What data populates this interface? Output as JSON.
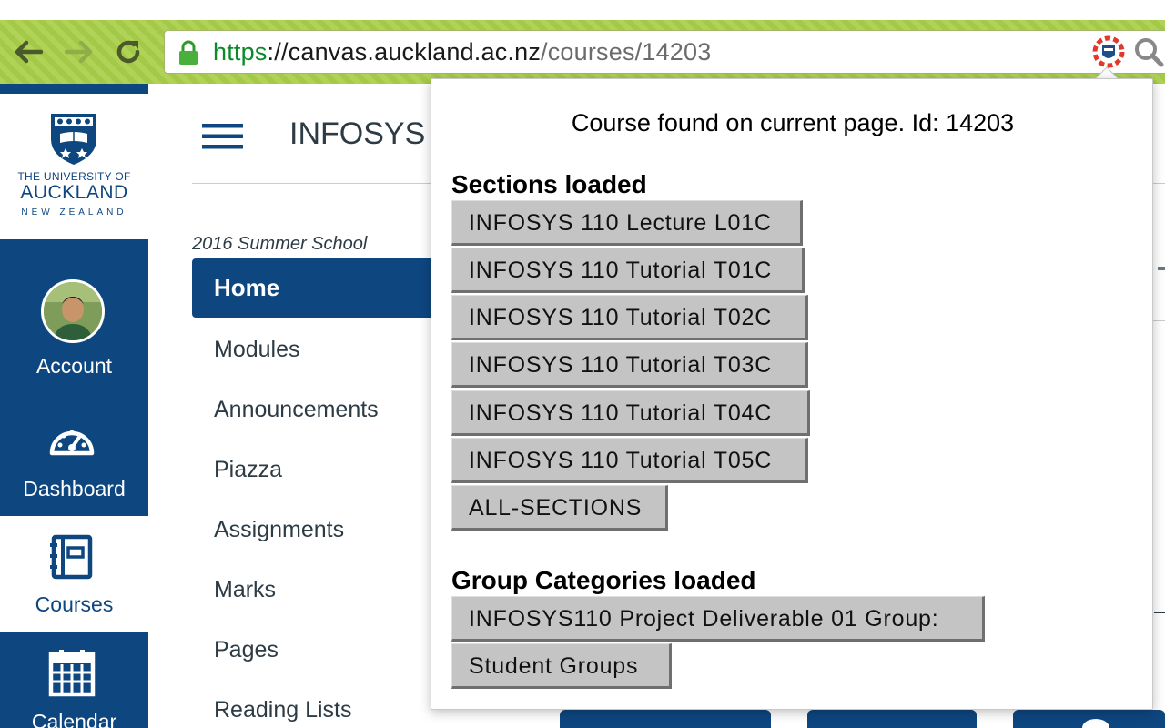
{
  "browser": {
    "url_scheme": "https",
    "url_sep": "://",
    "url_host": "canvas.auckland.ac.nz",
    "url_path": "/courses/14203",
    "back_icon": "arrow-left-icon",
    "forward_icon": "arrow-right-icon",
    "reload_icon": "reload-icon",
    "secure_icon": "lock-icon",
    "extension_icon": "canvas-extension-icon",
    "zoom_icon": "magnifier-icon"
  },
  "logo": {
    "line1": "THE UNIVERSITY OF",
    "line2": "AUCKLAND",
    "line3": "NEW ZEALAND"
  },
  "global_nav": {
    "account": "Account",
    "dashboard": "Dashboard",
    "courses": "Courses",
    "calendar": "Calendar"
  },
  "course": {
    "title": "INFOSYS",
    "term": "2016 Summer School",
    "nav": [
      "Home",
      "Modules",
      "Announcements",
      "Piazza",
      "Assignments",
      "Marks",
      "Pages",
      "Reading Lists"
    ]
  },
  "popup": {
    "status": "Course found on current page. Id: 14203",
    "sections_heading": "Sections loaded",
    "sections": [
      "INFOSYS 110 Lecture L01C",
      "INFOSYS 110 Tutorial T01C",
      "INFOSYS 110 Tutorial T02C",
      "INFOSYS 110 Tutorial T03C",
      "INFOSYS 110 Tutorial T04C",
      "INFOSYS 110 Tutorial T05C",
      "ALL-SECTIONS"
    ],
    "groups_heading": "Group Categories loaded",
    "groups": [
      "INFOSYS110 Project Deliverable 01 Group:",
      "Student Groups"
    ]
  },
  "colors": {
    "brand_blue": "#0e4680",
    "toolbar_green": "#a9cf4a",
    "button_gray": "#c4c4c4"
  }
}
